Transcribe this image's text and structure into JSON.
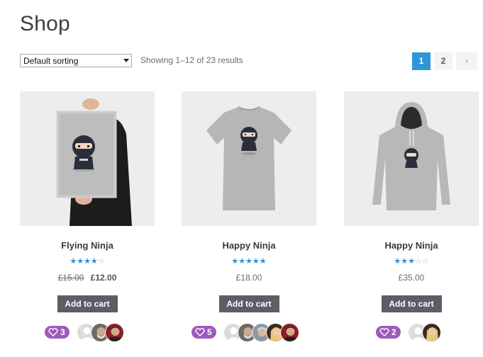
{
  "page": {
    "title": "Shop"
  },
  "toolbar": {
    "sorting": {
      "selected": "Default sorting"
    },
    "result_count": "Showing 1–12 of 23 results",
    "pagination": {
      "pages": [
        "1",
        "2"
      ],
      "current": "1",
      "next_label": "›"
    }
  },
  "products": [
    {
      "title": "Flying Ninja",
      "rating": 4.0,
      "old_price": "£15.00",
      "price": "£12.00",
      "button": "Add to cart",
      "likes": "3",
      "avatars": [
        "default-user",
        "bearded-man",
        "man-red"
      ]
    },
    {
      "title": "Happy Ninja",
      "rating": 5.0,
      "old_price": "",
      "price": "£18.00",
      "button": "Add to cart",
      "likes": "5",
      "avatars": [
        "default-user",
        "bearded-man",
        "older-man",
        "woman-blonde",
        "man-red"
      ]
    },
    {
      "title": "Happy Ninja",
      "rating": 3.0,
      "old_price": "",
      "price": "£35.00",
      "button": "Add to cart",
      "likes": "2",
      "avatars": [
        "default-user",
        "woman-blonde"
      ]
    }
  ],
  "colors": {
    "accent": "#2d96d8",
    "button": "#5b5e66",
    "likes_badge": "#9d5ab9"
  }
}
